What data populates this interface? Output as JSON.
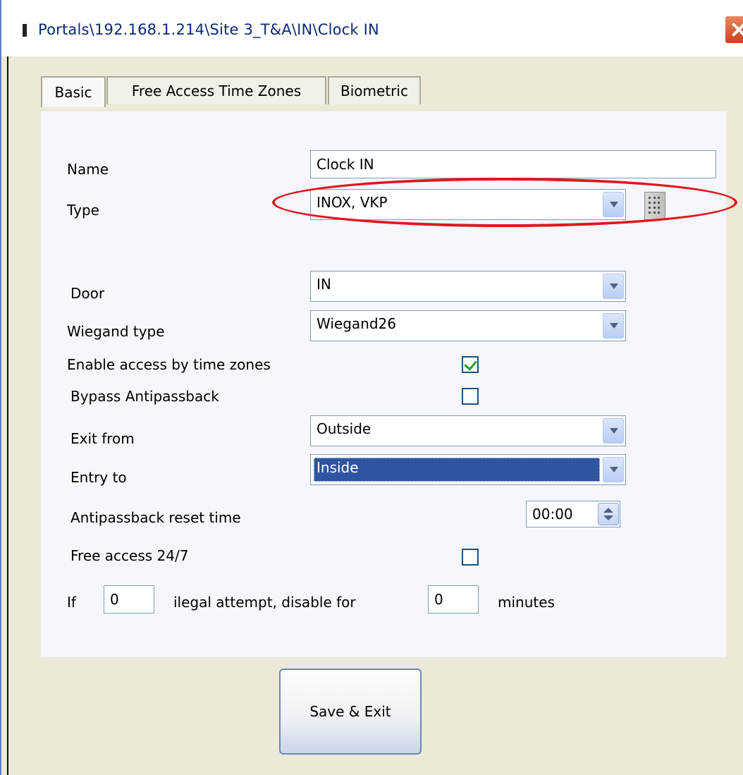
{
  "window": {
    "title": "Portals\\192.168.1.214\\Site 3_T&A\\IN\\Clock IN"
  },
  "tabs": [
    {
      "label": "Basic",
      "active": true
    },
    {
      "label": "Free Access Time Zones",
      "active": false
    },
    {
      "label": "Biometric",
      "active": false
    }
  ],
  "form": {
    "name_label": "Name",
    "name_value": "Clock IN",
    "type_label": "Type",
    "type_value": "INOX, VKP",
    "door_label": "Door",
    "door_value": "IN",
    "wiegand_label": "Wiegand type",
    "wiegand_value": "Wiegand26",
    "enable_tz_label": "Enable access by time zones",
    "enable_tz_checked": true,
    "bypass_label": "Bypass Antipassback",
    "bypass_checked": false,
    "exit_from_label": "Exit from",
    "exit_from_value": "Outside",
    "entry_to_label": "Entry to",
    "entry_to_value": "Inside",
    "apb_reset_label": "Antipassback reset time",
    "apb_reset_value": "00:00",
    "free_access_label": "Free access 24/7",
    "free_access_checked": false,
    "if_label": "If",
    "attempts_value": "0",
    "illegal_label": "ilegal attempt, disable for",
    "disable_minutes_value": "0",
    "minutes_label": "minutes"
  },
  "buttons": {
    "save_exit": "Save & Exit"
  },
  "colors": {
    "annotation": "#e0161d",
    "selection": "#2f55a0",
    "check": "#21a121"
  }
}
